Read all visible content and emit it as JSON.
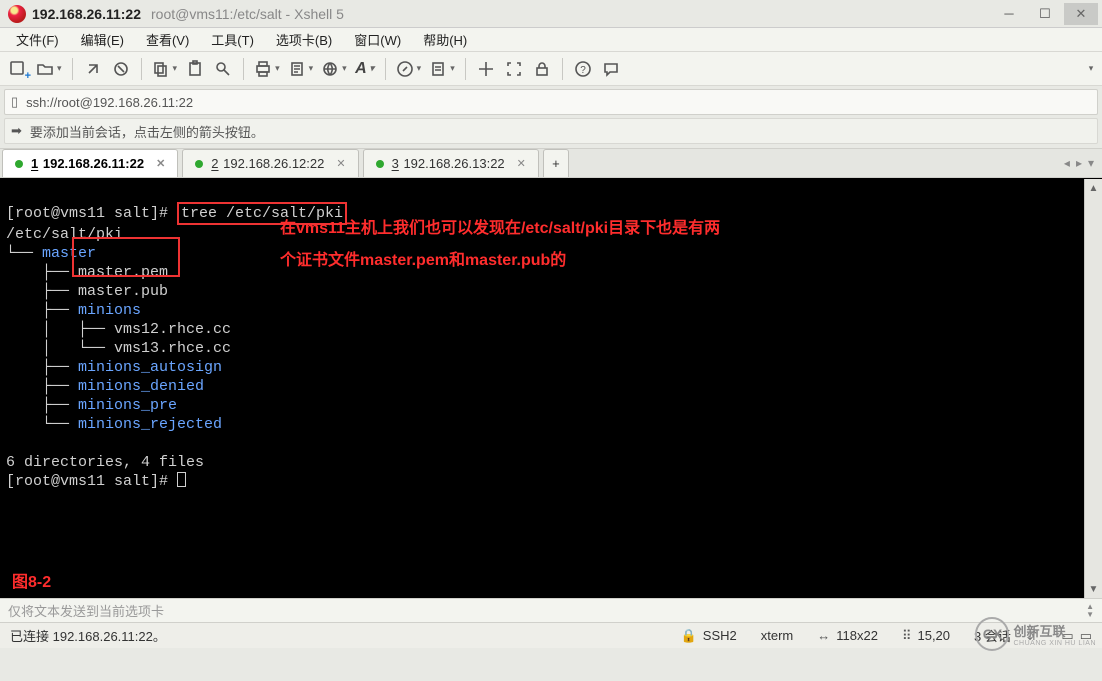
{
  "title": {
    "main": "192.168.26.11:22",
    "sub": "root@vms11:/etc/salt - Xshell 5"
  },
  "menus": {
    "file": "文件(F)",
    "edit": "编辑(E)",
    "view": "查看(V)",
    "tools": "工具(T)",
    "tab": "选项卡(B)",
    "window": "窗口(W)",
    "help": "帮助(H)"
  },
  "address": {
    "url": "ssh://root@192.168.26.11:22"
  },
  "hint": {
    "text": "要添加当前会话，点击左侧的箭头按钮。"
  },
  "tabs": [
    {
      "num": "1",
      "label": "192.168.26.11:22",
      "active": true
    },
    {
      "num": "2",
      "label": "192.168.26.12:22",
      "active": false
    },
    {
      "num": "3",
      "label": "192.168.26.13:22",
      "active": false
    }
  ],
  "terminal": {
    "prompt1": "[root@vms11 salt]# ",
    "cmd": "tree /etc/salt/pki",
    "path": "/etc/salt/pki",
    "tree": {
      "master": "master",
      "master_pem": "master.pem",
      "master_pub": "master.pub",
      "minions": "minions",
      "vms12": "vms12.rhce.cc",
      "vms13": "vms13.rhce.cc",
      "m_autosign": "minions_autosign",
      "m_denied": "minions_denied",
      "m_pre": "minions_pre",
      "m_rejected": "minions_rejected"
    },
    "summary": "6 directories, 4 files",
    "prompt2": "[root@vms11 salt]# ",
    "ann1": "在vms11主机上我们也可以发现在/etc/salt/pki目录下也是有两",
    "ann2": "个证书文件master.pem和master.pub的",
    "figlabel": "图8-2"
  },
  "sendbar": {
    "placeholder": "仅将文本发送到当前选项卡"
  },
  "status": {
    "conn": "已连接 192.168.26.11:22。",
    "proto": "SSH2",
    "term": "xterm",
    "size": "118x22",
    "pos": "15,20",
    "sessions_label": "3 会话",
    "scroll_icons": "⇡ ⇣"
  },
  "watermark": {
    "brand": "创新互联",
    "sub": "CHUANG XIN HU LIAN",
    "badge": "CX"
  }
}
